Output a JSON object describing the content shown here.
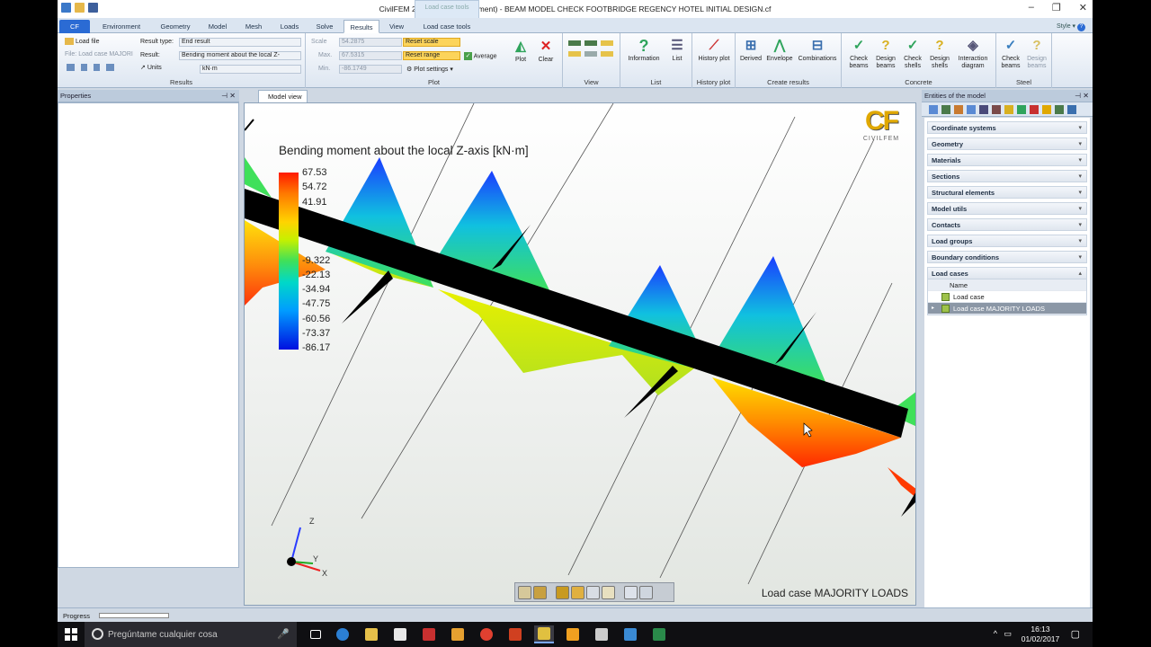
{
  "window": {
    "title": "CivilFEM 2016 SP4 (Development) - BEAM MODEL CHECK FOOTBRIDGE REGENCY HOTEL INITIAL DESIGN.cf",
    "context_band": "Load case tools",
    "controls": {
      "minimize": "–",
      "restore": "❐",
      "close": "✕"
    }
  },
  "tabs": {
    "file": "CF",
    "items": [
      "Environment",
      "Geometry",
      "Model",
      "Mesh",
      "Loads",
      "Solve",
      "Results",
      "View",
      "Load case tools"
    ],
    "active": "Results",
    "style_label": "Style"
  },
  "ribbon": {
    "results_group": {
      "label": "Results",
      "load_file": "Load file",
      "file_label": "File:",
      "file_value": "Load case MAJORI",
      "units_label": "Units",
      "result_type_label": "Result type:",
      "result_type_value": "End result",
      "result_label": "Result:",
      "result_value": "Bending moment about the local Z-",
      "units_value": "kN·m"
    },
    "plot_group": {
      "label": "Plot",
      "scale_label": "Scale",
      "scale_value": "54.2875",
      "max_label": "Max.",
      "max_value": "67.5315",
      "min_label": "Min.",
      "min_value": "-86.1749",
      "reset_scale": "Reset scale",
      "reset_range": "Reset range",
      "average": "Average",
      "plot_settings": "Plot settings",
      "plot": "Plot",
      "clear": "Clear"
    },
    "view_group": {
      "label": "View"
    },
    "list_group": {
      "label": "List",
      "information": "Information",
      "list": "List"
    },
    "history_group": {
      "label": "History plot",
      "history_plot": "History plot"
    },
    "create_group": {
      "label": "Create results",
      "derived": "Derived",
      "envelope": "Envelope",
      "combinations": "Combinations"
    },
    "concrete_group": {
      "label": "Concrete",
      "check_beams": "Check beams",
      "design_beams": "Design beams",
      "check_shells": "Check shells",
      "design_shells": "Design shells",
      "interaction": "Interaction diagram"
    },
    "steel_group": {
      "label": "Steel",
      "check_beams": "Check beams",
      "design_beams": "Design beams"
    }
  },
  "properties_panel": {
    "title": "Properties"
  },
  "progress": {
    "label": "Progress"
  },
  "model_view": {
    "tab_label": "Model view",
    "plot_title": "Bending moment about the local Z-axis [kN·m]",
    "legend_values": [
      "67.53",
      "54.72",
      "41.91",
      "",
      "",
      "-9.322",
      "-22.13",
      "-34.94",
      "-47.75",
      "-60.56",
      "-73.37",
      "-86.17"
    ],
    "logo_text": "CF",
    "logo_sub": "CIVILFEM",
    "status": "Load case MAJORITY LOADS",
    "axes": {
      "z": "Z",
      "y": "Y",
      "x": "X"
    }
  },
  "entities_panel": {
    "title": "Entities of the model",
    "sections": [
      "Coordinate systems",
      "Geometry",
      "Materials",
      "Sections",
      "Structural elements",
      "Model utils",
      "Contacts",
      "Load groups",
      "Boundary conditions"
    ],
    "load_cases_section": "Load cases",
    "table_header": "Name",
    "rows": [
      "Load case",
      "Load case MAJORITY LOADS"
    ],
    "selected_row": 1
  },
  "taskbar": {
    "search_placeholder": "Pregúntame cualquier cosa",
    "time": "16:13",
    "date": "01/02/2017"
  },
  "colors": {
    "accent": "#2b6bd4",
    "ribbon_highlight": "#fcd45a",
    "selection": "#8b97a6"
  }
}
